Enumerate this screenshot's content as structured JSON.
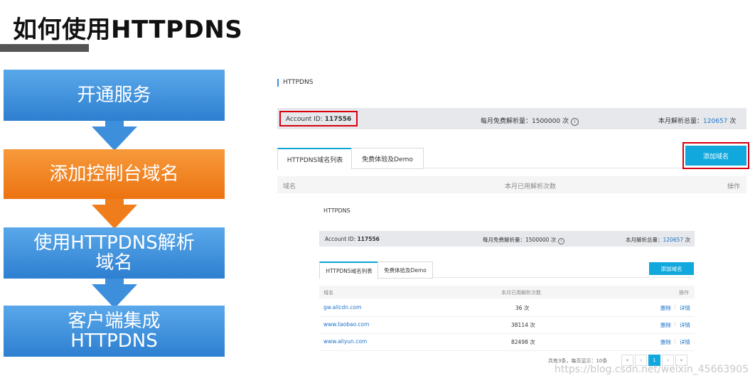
{
  "slide": {
    "title": "如何使用HTTPDNS",
    "steps": [
      {
        "label": "开通服务"
      },
      {
        "label": "添加控制台域名"
      },
      {
        "label": "使用HTTPDNS解析\n域名"
      },
      {
        "label": "客户端集成\nHTTPDNS"
      }
    ]
  },
  "console_main": {
    "breadcrumb": "HTTPDNS",
    "account_label": "Account ID: ",
    "account_id": "117556",
    "free_quota": "每月免费解析量：1500000 次",
    "month_total_label": "本月解析总量：",
    "month_total_value": "120657",
    "month_total_unit": "次",
    "tabs": [
      "HTTPDNS域名列表",
      "免费体验及Demo"
    ],
    "add_button": "添加域名",
    "table_headers": [
      "域名",
      "本月已用解析次数",
      "操作"
    ]
  },
  "console_inset": {
    "breadcrumb": "HTTPDNS",
    "account_label": "Account ID: ",
    "account_id": "117556",
    "free_quota": "每月免费解析量：1500000 次",
    "month_total_label": "本月解析总量：",
    "month_total_value": "120657",
    "month_total_unit": "次",
    "tabs": [
      "HTTPDNS域名列表",
      "免费体验及Demo"
    ],
    "add_button": "添加域名",
    "table_headers": [
      "域名",
      "本月已用解析次数",
      "操作"
    ],
    "rows": [
      {
        "domain": "gw.alicdn.com",
        "count": "36 次",
        "delete": "删除",
        "detail": "详情"
      },
      {
        "domain": "www.taobao.com",
        "count": "38114 次",
        "delete": "删除",
        "detail": "详情"
      },
      {
        "domain": "www.aliyun.com",
        "count": "82498 次",
        "delete": "删除",
        "detail": "详情"
      }
    ],
    "pager": {
      "summary": "共有3条，每页显示：10条",
      "first": "«",
      "prev": "‹",
      "current": "1",
      "next": "›",
      "last": "»"
    }
  },
  "watermark": "https://blog.csdn.net/weixin_45663905",
  "colors": {
    "accent": "#11a9dd",
    "flow_blue": "#3d8fdc",
    "flow_orange": "#ef7d1c",
    "highlight_red": "#d7000f"
  }
}
